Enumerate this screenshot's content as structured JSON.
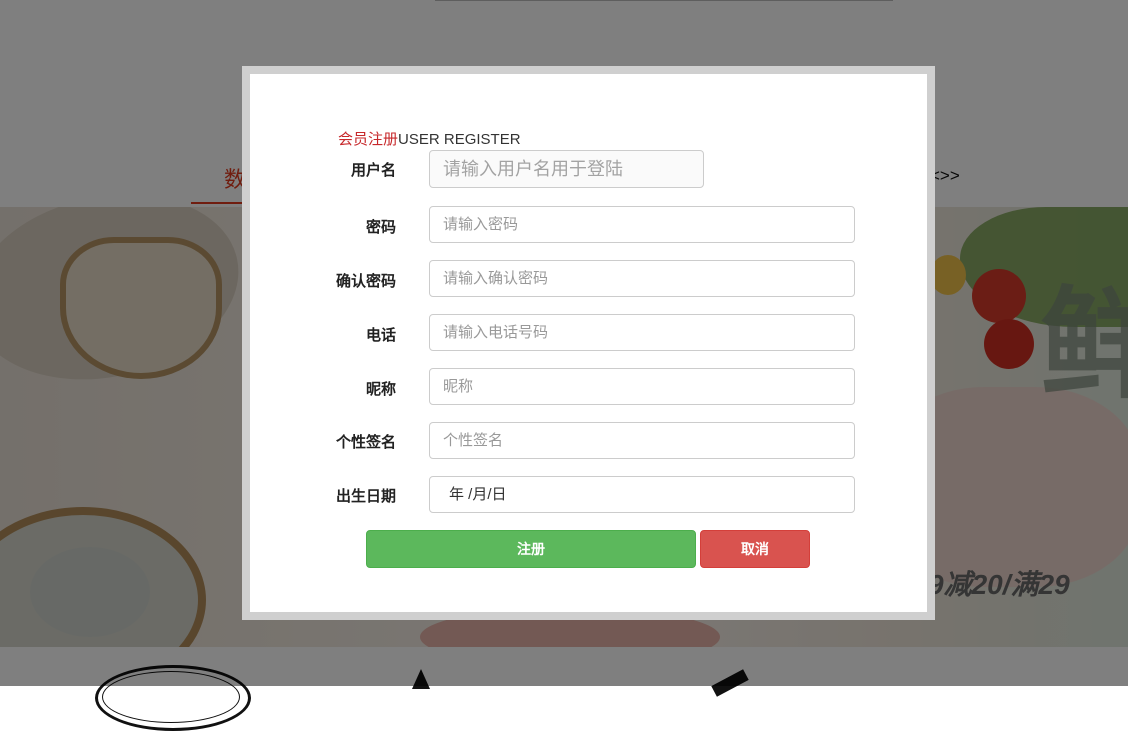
{
  "background": {
    "nav_left_fragment": "数",
    "nav_right_fragment": "<>>",
    "title_fragment": "",
    "promo_fragment": "9减20/满29",
    "big_char_fragment": "鲜"
  },
  "modal": {
    "heading_red": "会员注册",
    "heading_rest": "USER REGISTER",
    "fields": {
      "username": {
        "label": "用户名",
        "placeholder": "请输入用户名用于登陆",
        "value": ""
      },
      "password": {
        "label": "密码",
        "placeholder": "请输入密码",
        "value": ""
      },
      "confirm_password": {
        "label": "确认密码",
        "placeholder": "请输入确认密码",
        "value": ""
      },
      "phone": {
        "label": "电话",
        "placeholder": "请输入电话号码",
        "value": ""
      },
      "nickname": {
        "label": "昵称",
        "placeholder": "昵称",
        "value": ""
      },
      "signature": {
        "label": "个性签名",
        "placeholder": "个性签名",
        "value": ""
      },
      "birthday": {
        "label": "出生日期",
        "display": "年 /月/日"
      }
    },
    "buttons": {
      "register": "注册",
      "cancel": "取消"
    }
  },
  "colors": {
    "accent_red": "#c7282b",
    "register_green": "#5cb85c",
    "cancel_red": "#d9534f"
  }
}
